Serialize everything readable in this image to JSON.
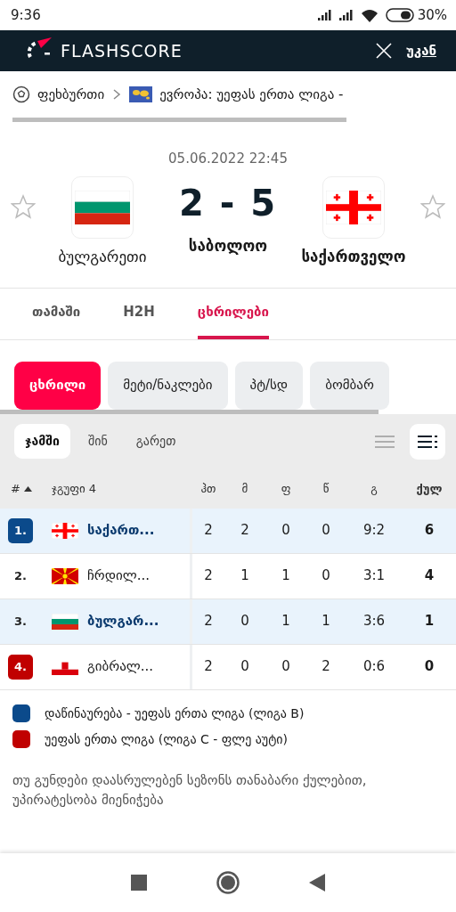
{
  "status_bar": {
    "time": "9:36",
    "battery": "30%"
  },
  "header": {
    "logo": "FLASHSCORE",
    "back": "უკან"
  },
  "breadcrumb": {
    "sport": "ფეხბურთი",
    "competition": "ევროპა: უეფას ერთა ლიგა -"
  },
  "match": {
    "datetime": "05.06.2022 22:45",
    "score": "2 - 5",
    "status": "საბოლოო",
    "home": {
      "name": "ბულგარეთი",
      "favorite": false,
      "bold": false
    },
    "away": {
      "name": "საქართველო",
      "favorite": false,
      "bold": true
    }
  },
  "tabs": [
    {
      "label": "თამაში",
      "selected": false
    },
    {
      "label": "H2H",
      "selected": false
    },
    {
      "label": "ცხრილები",
      "selected": true
    }
  ],
  "pills": [
    {
      "label": "ცხრილი",
      "selected": true
    },
    {
      "label": "მეტი/ნაკლები",
      "selected": false
    },
    {
      "label": "პტ/სდ",
      "selected": false
    },
    {
      "label": "ბომბარ",
      "selected": false
    }
  ],
  "filters": [
    {
      "label": "ჯამში",
      "selected": true
    },
    {
      "label": "შინ",
      "selected": false
    },
    {
      "label": "გარეთ",
      "selected": false
    }
  ],
  "views": [
    {
      "selected": false
    },
    {
      "selected": true
    }
  ],
  "table": {
    "columns": [
      "#",
      "ჯგუფი 4",
      "ჰთ",
      "მ",
      "ფ",
      "წ",
      "გ",
      "ქულ"
    ],
    "rows": [
      {
        "color": "#0b4a8b",
        "highlighted": true,
        "cells": [
          "1.",
          "საქართ...",
          "2",
          "2",
          "0",
          "0",
          "9:2",
          "6"
        ]
      },
      {
        "highlighted": false,
        "cells": [
          "2.",
          "ჩრდილ...",
          "2",
          "1",
          "1",
          "0",
          "3:1",
          "4"
        ]
      },
      {
        "highlighted": true,
        "cells": [
          "3.",
          "ბულგარ...",
          "2",
          "0",
          "1",
          "1",
          "3:6",
          "1"
        ]
      },
      {
        "color": "#c00000",
        "highlighted": false,
        "cells": [
          "4.",
          "გიბრალ...",
          "2",
          "0",
          "0",
          "2",
          "0:6",
          "0"
        ]
      }
    ]
  },
  "legend": [
    {
      "color": "#0b4a8b",
      "label": "დაწინაურება - უეფას ერთა ლიგა (ლიგა B)"
    },
    {
      "color": "#c00000",
      "label": "უეფას ერთა ლიგა (ლიგა C - ფლე აუტი)"
    }
  ],
  "note": "თუ გუნდები დაასრულებენ სეზონს თანაბარი ქულებით, უპირატესობა მიენიჭება"
}
